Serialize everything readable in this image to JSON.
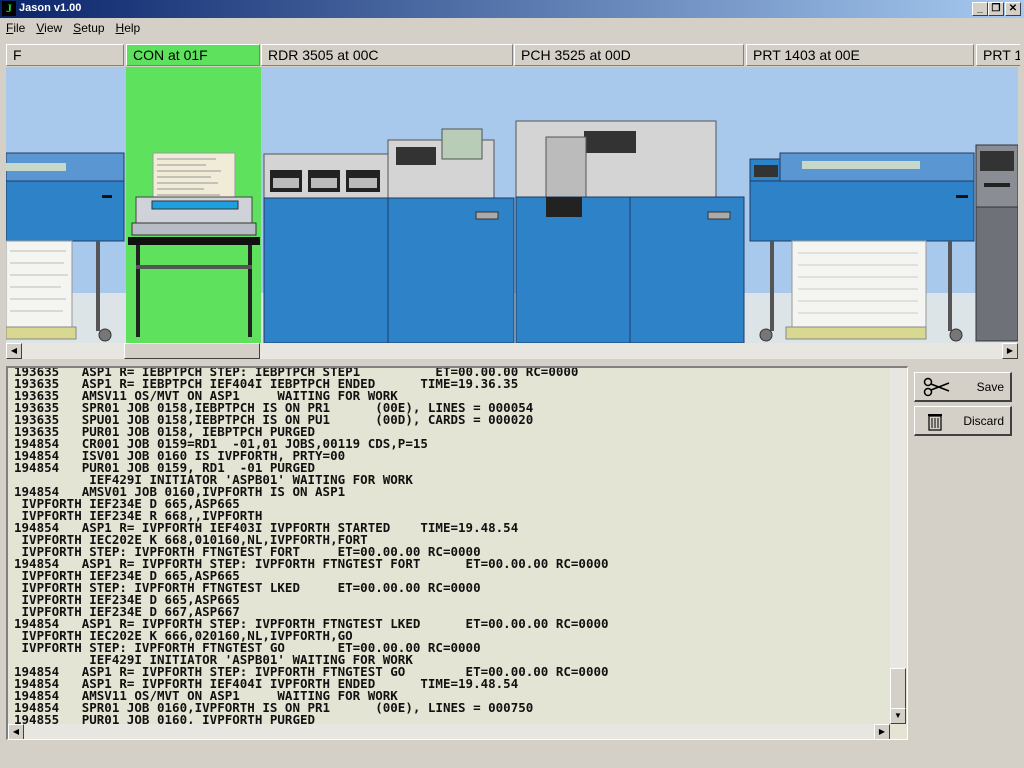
{
  "window": {
    "title": "Jason v1.00",
    "icon_letter": "J"
  },
  "menu": [
    {
      "first": "F",
      "rest": "ile"
    },
    {
      "first": "V",
      "rest": "iew"
    },
    {
      "first": "S",
      "rest": "etup"
    },
    {
      "first": "H",
      "rest": "elp"
    }
  ],
  "devices": {
    "tabs": [
      {
        "label": "F",
        "active": false
      },
      {
        "label": "CON at 01F",
        "active": true
      },
      {
        "label": "RDR 3505 at 00C",
        "active": false
      },
      {
        "label": "PCH 3525 at 00D",
        "active": false
      },
      {
        "label": "PRT 1403 at 00E",
        "active": false
      },
      {
        "label": "PRT 1",
        "active": false
      }
    ]
  },
  "buttons": {
    "save": "Save",
    "discard": "Discard"
  },
  "icons": {
    "save": "scissors-icon",
    "discard": "trash-icon"
  },
  "colors": {
    "active_device": "#5ee25e",
    "device_blue": "#2d82c8",
    "backdrop": "#a8c8ec",
    "console_bg": "#e4e4d4"
  },
  "console": {
    "partial_top": "193635   ASP1 R= IEBPTPCH STEP: IEBPTPCH STEP1          ET=00.00.00 RC=0000",
    "lines": [
      "193635   ASP1 R= IEBPTPCH IEF404I IEBPTPCH ENDED      TIME=19.36.35",
      "193635   AMSV11 OS/MVT ON ASP1     WAITING FOR WORK",
      "193635   SPR01 JOB 0158,IEBPTPCH IS ON PR1      (00E), LINES = 000054",
      "193635   SPU01 JOB 0158,IEBPTPCH IS ON PU1      (00D), CARDS = 000020",
      "193635   PUR01 JOB 0158, IEBPTPCH PURGED",
      "194854   CR001 JOB 0159=RD1  -01,01 JOBS,00119 CDS,P=15",
      "194854   ISV01 JOB 0160 IS IVPFORTH, PRTY=00",
      "194854   PUR01 JOB 0159, RD1  -01 PURGED",
      "          IEF429I INITIATOR 'ASPB01' WAITING FOR WORK",
      "194854   AMSV01 JOB 0160,IVPFORTH IS ON ASP1",
      " IVPFORTH IEF234E D 665,ASP665",
      " IVPFORTH IEF234E R 668,,IVPFORTH",
      "194854   ASP1 R= IVPFORTH IEF403I IVPFORTH STARTED    TIME=19.48.54",
      " IVPFORTH IEC202E K 668,010160,NL,IVPFORTH,FORT",
      " IVPFORTH STEP: IVPFORTH FTNGTEST FORT     ET=00.00.00 RC=0000",
      "194854   ASP1 R= IVPFORTH STEP: IVPFORTH FTNGTEST FORT      ET=00.00.00 RC=0000",
      " IVPFORTH IEF234E D 665,ASP665",
      " IVPFORTH STEP: IVPFORTH FTNGTEST LKED     ET=00.00.00 RC=0000",
      " IVPFORTH IEF234E D 665,ASP665",
      " IVPFORTH IEF234E D 667,ASP667",
      "194854   ASP1 R= IVPFORTH STEP: IVPFORTH FTNGTEST LKED      ET=00.00.00 RC=0000",
      " IVPFORTH IEC202E K 666,020160,NL,IVPFORTH,GO",
      " IVPFORTH STEP: IVPFORTH FTNGTEST GO       ET=00.00.00 RC=0000",
      "          IEF429I INITIATOR 'ASPB01' WAITING FOR WORK",
      "194854   ASP1 R= IVPFORTH STEP: IVPFORTH FTNGTEST GO        ET=00.00.00 RC=0000",
      "194854   ASP1 R= IVPFORTH IEF404I IVPFORTH ENDED      TIME=19.48.54",
      "194854   AMSV11 OS/MVT ON ASP1     WAITING FOR WORK",
      "194854   SPR01 JOB 0160,IVPFORTH IS ON PR1      (00E), LINES = 000750",
      "194855   PUR01 JOB 0160, IVPFORTH PURGED"
    ]
  }
}
